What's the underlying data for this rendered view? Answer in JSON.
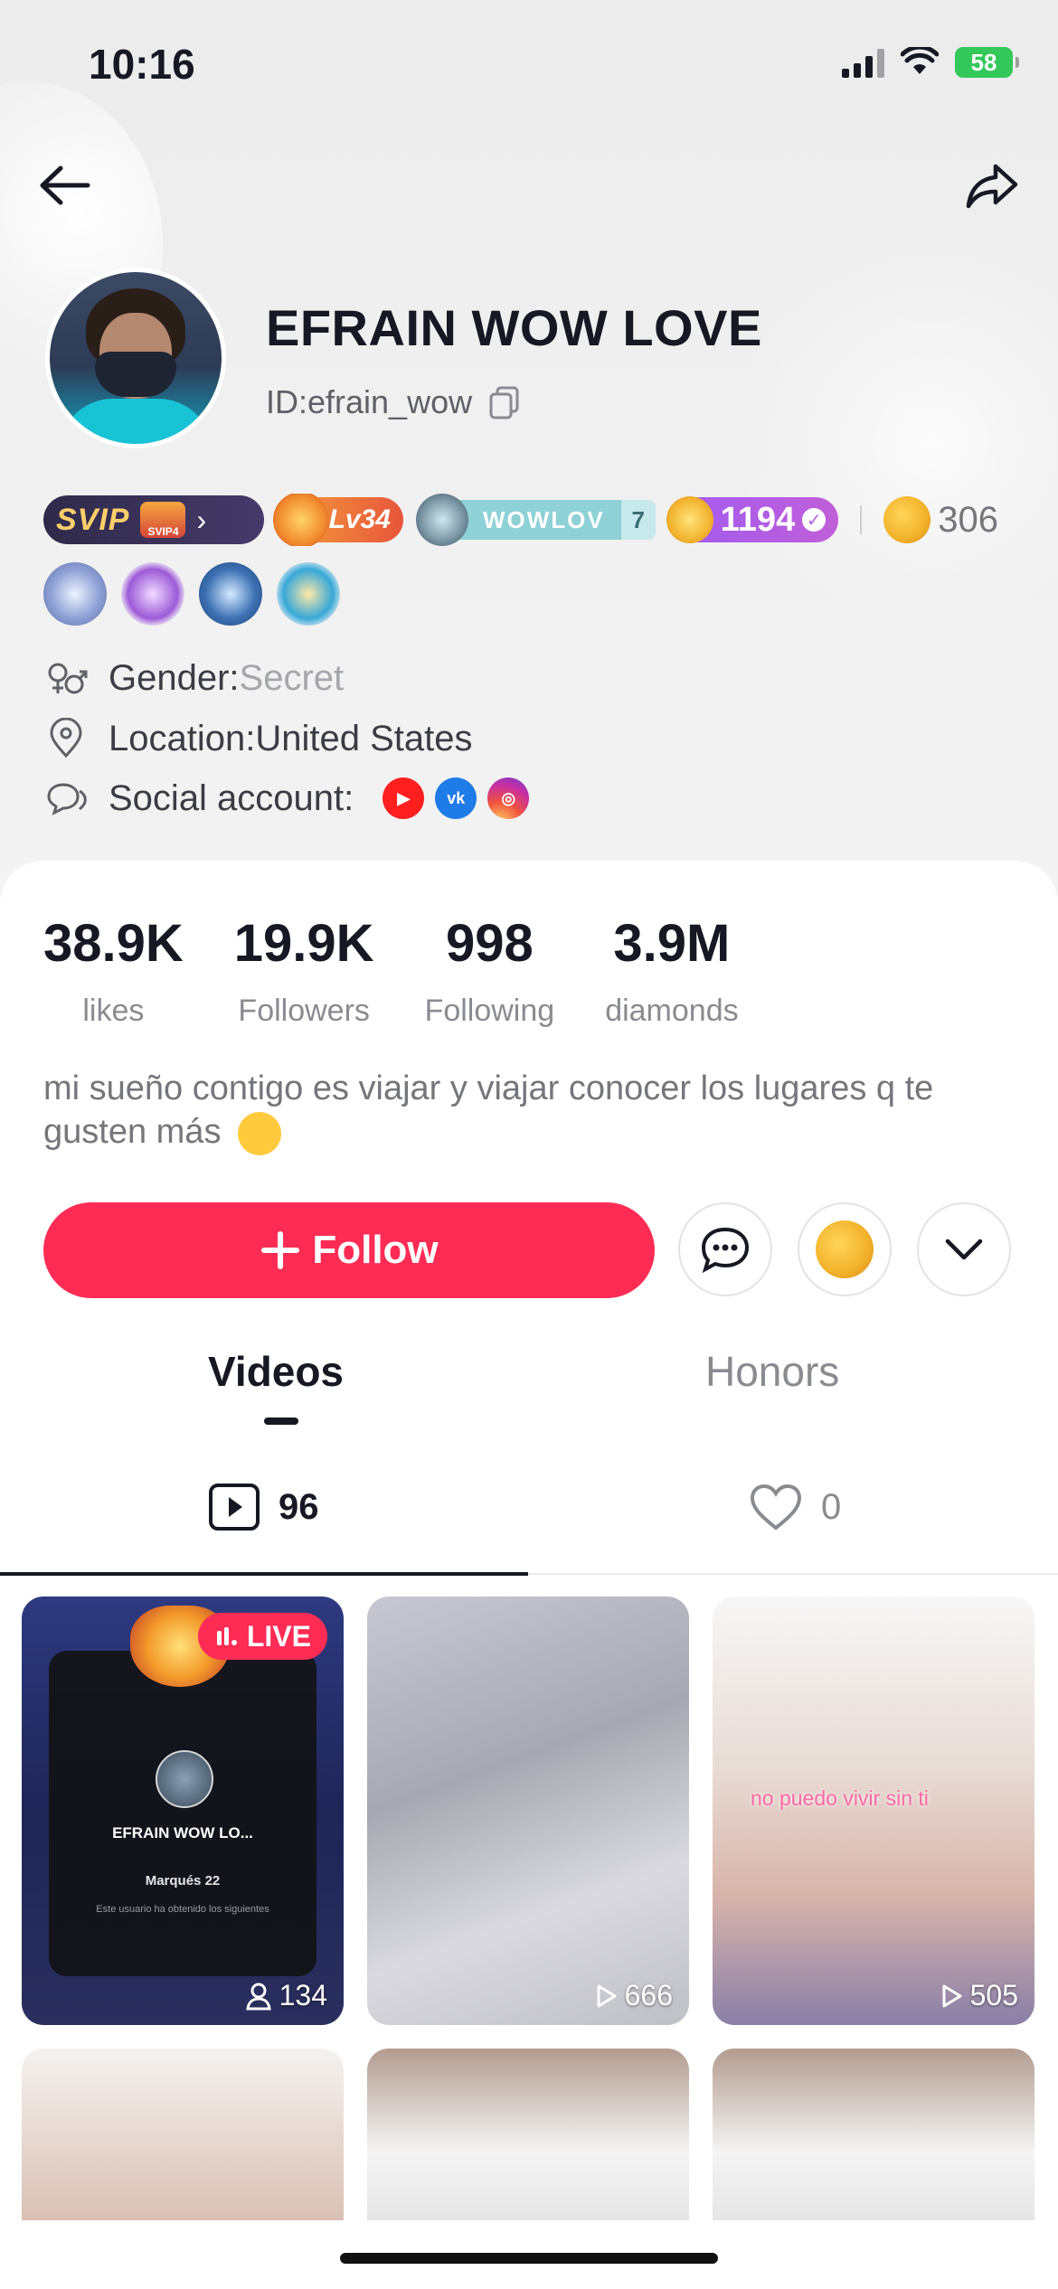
{
  "status": {
    "time": "10:16",
    "battery": "58"
  },
  "profile": {
    "name": "EFRAIN WOW LOVE",
    "id": "ID:efrain_wow",
    "badges": {
      "svip": "SVIP",
      "svip_level": "SVIP4",
      "level": "Lv34",
      "fan_club": "WOWLOV",
      "fan_level": "7",
      "coins": "1194",
      "gold": "306"
    },
    "gender_label": "Gender:",
    "gender_value": "Secret",
    "location": "Location:United States",
    "social_label": "Social account:"
  },
  "stats": [
    {
      "value": "38.9K",
      "label": "likes"
    },
    {
      "value": "19.9K",
      "label": "Followers"
    },
    {
      "value": "998",
      "label": "Following"
    },
    {
      "value": "3.9M",
      "label": "diamonds"
    }
  ],
  "bio": "mi sueño contigo es viajar y viajar conocer los lugares q te gusten más",
  "actions": {
    "follow": "Follow"
  },
  "tabs": {
    "videos": "Videos",
    "honors": "Honors"
  },
  "subtabs": {
    "videos_count": "96",
    "liked_count": "0"
  },
  "videos": [
    {
      "badge": "LIVE",
      "views": "134",
      "live_name": "EFRAIN WOW LO...",
      "live_rank": "Marqués 22",
      "live_desc": "Este usuario ha obtenido los siguientes"
    },
    {
      "views": "666"
    },
    {
      "views": "505",
      "caption": "no puedo vivir sin ti"
    }
  ],
  "colors": {
    "accent": "#fe2c55",
    "text": "#161823",
    "muted": "#8a8b91"
  }
}
